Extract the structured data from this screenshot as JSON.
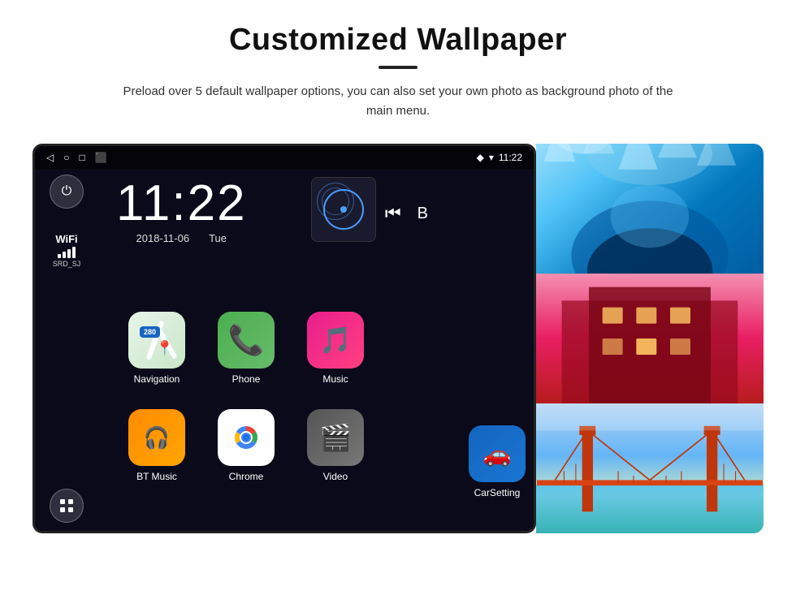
{
  "header": {
    "title": "Customized Wallpaper",
    "subtitle": "Preload over 5 default wallpaper options, you can also set your own photo as background photo of the main menu."
  },
  "device": {
    "time": "11:22",
    "date_left": "2018-11-06",
    "date_right": "Tue",
    "wifi_label": "WiFi",
    "wifi_ssid": "SRD_SJ"
  },
  "apps": [
    {
      "label": "Navigation",
      "id": "navigation"
    },
    {
      "label": "Phone",
      "id": "phone"
    },
    {
      "label": "Music",
      "id": "music"
    },
    {
      "label": "BT Music",
      "id": "bt-music"
    },
    {
      "label": "Chrome",
      "id": "chrome"
    },
    {
      "label": "Video",
      "id": "video"
    },
    {
      "label": "CarSetting",
      "id": "car-setting"
    }
  ],
  "nav_shield_text": "280",
  "status": {
    "time": "11:22"
  }
}
